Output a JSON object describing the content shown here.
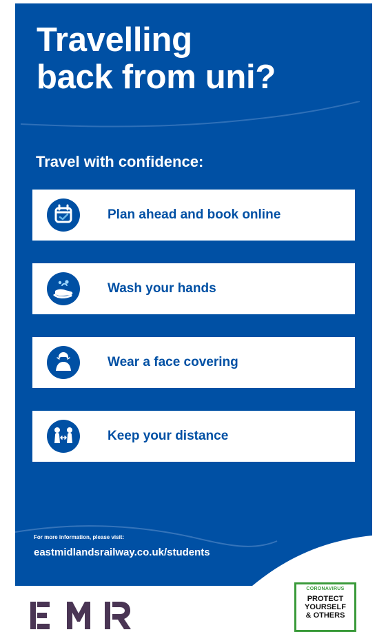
{
  "colors": {
    "brand_blue": "#0050a4",
    "white": "#ffffff",
    "logo_purple": "#4a3554",
    "badge_green": "#3a9a3a"
  },
  "poster": {
    "title_line1": "Travelling",
    "title_line2": "back from uni?",
    "subtitle": "Travel with confidence:"
  },
  "tips": [
    {
      "label": "Plan ahead and book online",
      "icon": "calendar-icon"
    },
    {
      "label": "Wash your hands",
      "icon": "hand-washing-icon"
    },
    {
      "label": "Wear a face covering",
      "icon": "face-covering-icon"
    },
    {
      "label": "Keep your distance",
      "icon": "distance-icon"
    }
  ],
  "footer": {
    "note": "For more information, please visit:",
    "link": "eastmidlandsrailway.co.uk/students"
  },
  "logo": {
    "text": "EMR"
  },
  "badge": {
    "top": "CORONAVIRUS",
    "line1": "PROTECT",
    "line2": "YOURSELF",
    "line3": "& OTHERS"
  }
}
